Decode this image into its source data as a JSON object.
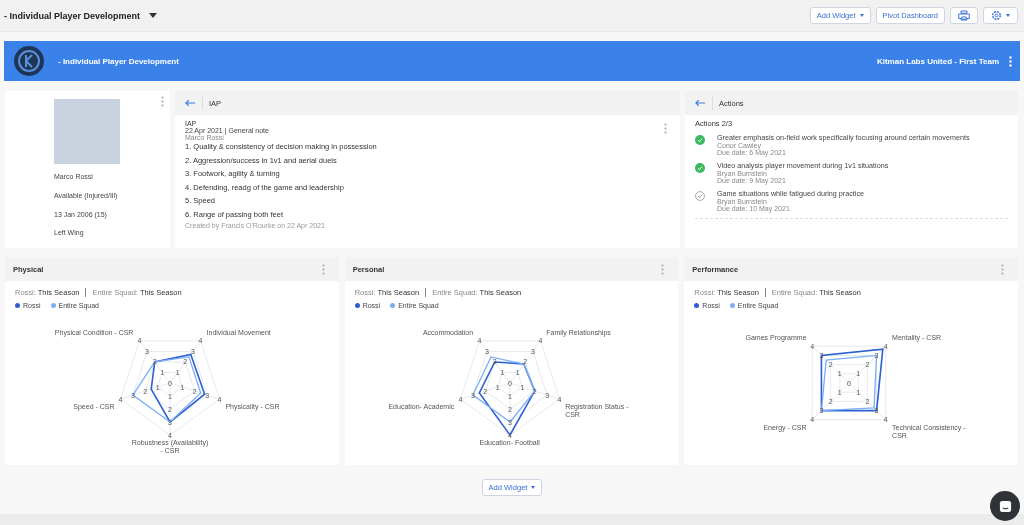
{
  "toolbar": {
    "title": "- Individual Player Development",
    "add_widget": "Add Widget",
    "pivot": "Pivot Dashboard"
  },
  "banner": {
    "title": "- Individual Player Development",
    "team": "Kitman Labs United - First Team"
  },
  "profile": {
    "name": "Marco Rossi",
    "status": "Available (Injured/Ill)",
    "dob": "13 Jan 2006 (15)",
    "position": "Left Wing"
  },
  "iap": {
    "header": "IAP",
    "note": {
      "title": "IAP",
      "meta": "22 Apr 2021 | General note",
      "author": "Marco Rossi",
      "items": [
        "1. Quality & consistency of decision making in possession",
        "2. Aggression/success in 1v1 and aerial duels",
        "3. Footwork, agility & turning",
        "4. Defending, readg of the game and leadership",
        "5. Speed",
        "6. Range of passing both feet"
      ],
      "footer": "Created by Francis O'Rourke on 22 Apr 2021"
    }
  },
  "actions": {
    "header": "Actions",
    "summary": "Actions 2/3",
    "items": [
      {
        "text": "Greater emphasis on-field work specifically focusing around certain movements",
        "assignee": "Conor Cawley",
        "due": "Due date: 6 May 2021",
        "completed": true
      },
      {
        "text": "Video analysis player movement during 1v1 situations",
        "assignee": "Bryan Burnstein",
        "due": "Due date: 9 May 2021",
        "completed": true
      },
      {
        "text": "Game situations while fatigued during practice",
        "assignee": "Bryan Burnstein",
        "due": "Due date: 10 May 2021",
        "completed": false
      }
    ]
  },
  "widgets": [
    {
      "title": "Physical",
      "filters": [
        {
          "label": "Rossi:",
          "value": "This Season"
        },
        {
          "label": "Entire Squad:",
          "value": "This Season"
        }
      ],
      "radar": {
        "center_label": "0",
        "axes": [
          {
            "label": "Physical Condition - CSR",
            "ticks": [
              "1",
              "2",
              "3",
              "4"
            ]
          },
          {
            "label": "Individual Movement",
            "ticks": [
              "1",
              "2",
              "3",
              "4"
            ]
          },
          {
            "label": "Speed - CSR",
            "ticks": [
              "1",
              "2",
              "3",
              "4"
            ]
          },
          {
            "label": "Physicality - CSR",
            "ticks": [
              "1",
              "2",
              "3",
              "4"
            ]
          },
          {
            "label": "Robustness (Availability) - CSR",
            "ticks": [
              "1",
              "2",
              "3",
              "4"
            ]
          }
        ],
        "series": [
          {
            "name": "Rossi",
            "color": "#2c5fcf"
          },
          {
            "name": "Entire Squad",
            "color": "#7aaef5"
          }
        ]
      }
    },
    {
      "title": "Personal",
      "filters": [
        {
          "label": "Rossi:",
          "value": "This Season"
        },
        {
          "label": "Entire Squad:",
          "value": "This Season"
        }
      ],
      "radar": {
        "center_label": "0",
        "axes": [
          {
            "label": "Accommodation",
            "ticks": [
              "1",
              "2",
              "3",
              "4"
            ]
          },
          {
            "label": "Family Relationships",
            "ticks": [
              "1",
              "2",
              "3",
              "4"
            ]
          },
          {
            "label": "Education- Academic",
            "ticks": [
              "1",
              "2",
              "3",
              "4"
            ]
          },
          {
            "label": "Registration Status - CSR",
            "ticks": [
              "1",
              "2",
              "3",
              "4"
            ]
          },
          {
            "label": "Education- Football",
            "ticks": [
              "1",
              "2",
              "3",
              "4"
            ]
          }
        ],
        "series": [
          {
            "name": "Rossi",
            "color": "#2c5fcf"
          },
          {
            "name": "Entire Squad",
            "color": "#7aaef5"
          }
        ]
      }
    },
    {
      "title": "Performance",
      "filters": [
        {
          "label": "Rossi:",
          "value": "This Season"
        },
        {
          "label": "Entire Squad:",
          "value": "This Season"
        }
      ],
      "radar": {
        "center_label": "0",
        "axes": [
          {
            "label": "Games Programme",
            "ticks": [
              "1",
              "2",
              "3",
              "4"
            ]
          },
          {
            "label": "Mentality - CSR",
            "ticks": [
              "1",
              "2",
              "3",
              "4"
            ]
          },
          {
            "label": "Energy - CSR",
            "ticks": [
              "1",
              "2",
              "3",
              "4"
            ]
          },
          {
            "label": "Technical Consistency - CSR",
            "ticks": [
              "1",
              "2",
              "3",
              "4"
            ]
          }
        ],
        "series": [
          {
            "name": "Rossi",
            "color": "#2c5fcf"
          },
          {
            "name": "Entire Squad",
            "color": "#7aaef5"
          }
        ]
      }
    }
  ],
  "add_widget": "Add Widget"
}
